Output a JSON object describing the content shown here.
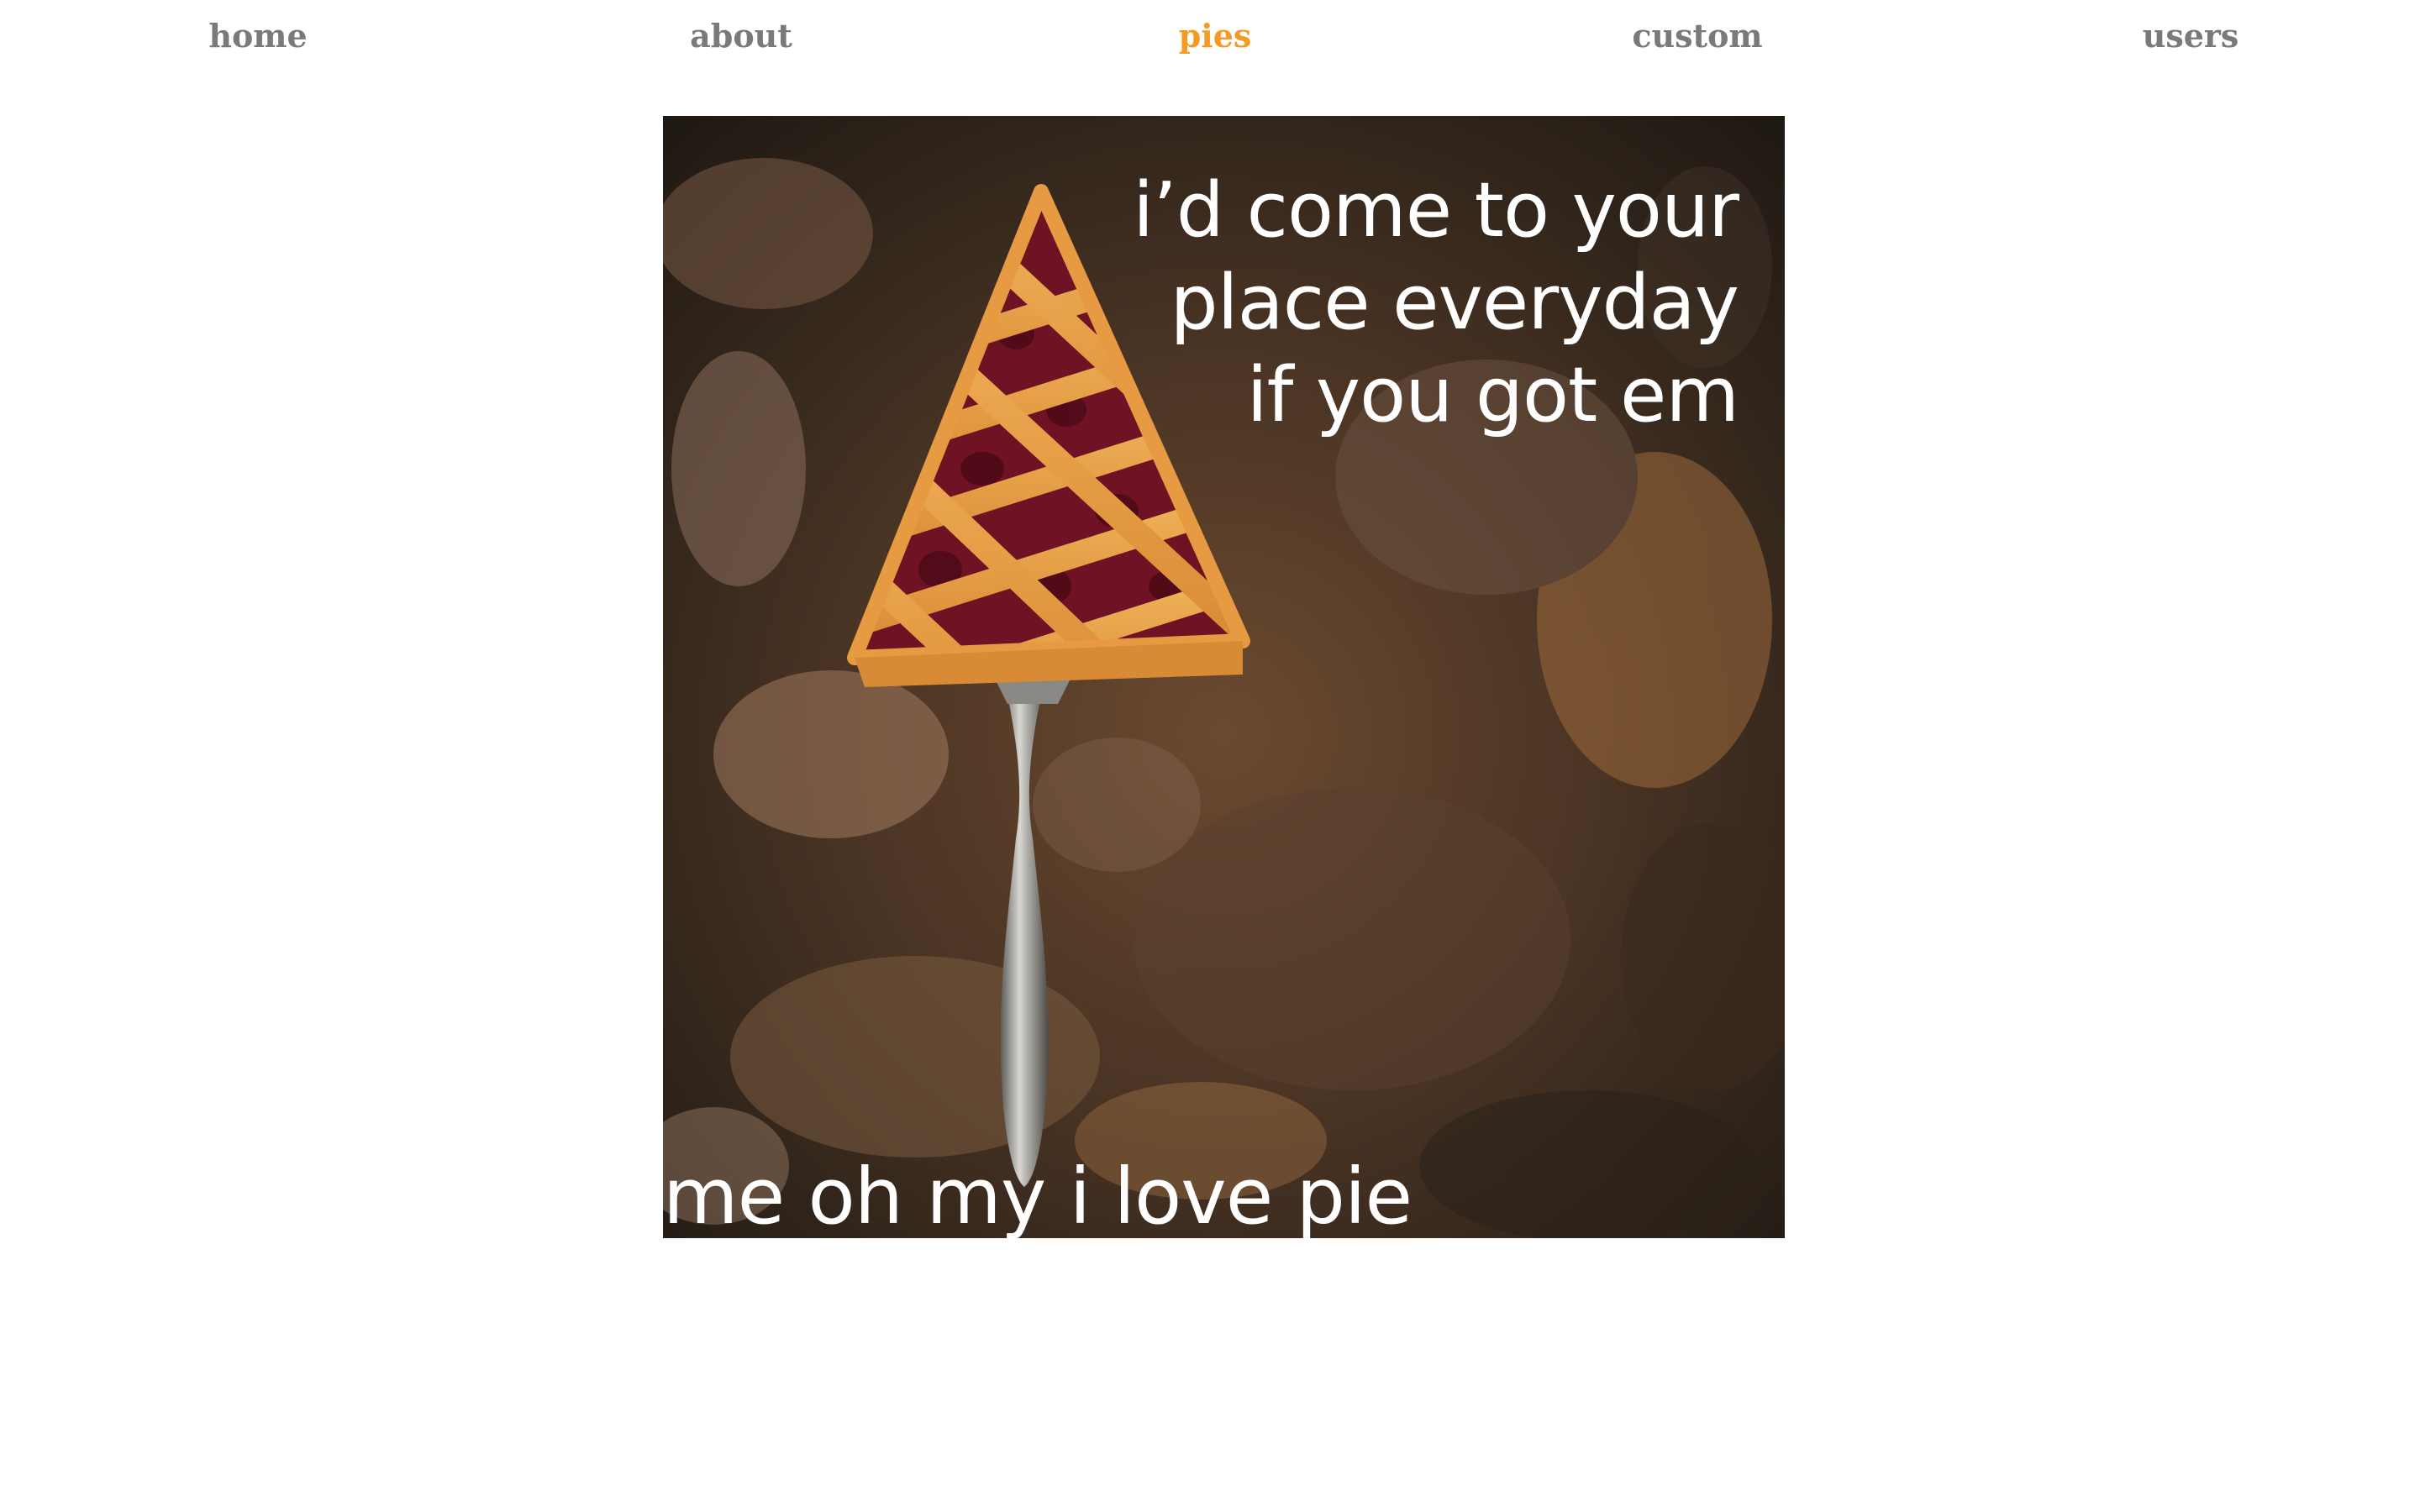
{
  "nav": {
    "items": [
      {
        "label": "home",
        "active": false
      },
      {
        "label": "about",
        "active": false
      },
      {
        "label": "pies",
        "active": true
      },
      {
        "label": "custom",
        "active": false
      },
      {
        "label": "users",
        "active": false
      }
    ],
    "active_color": "#f59a23",
    "inactive_color": "#7a7a7a"
  },
  "meme": {
    "image": "cherry-pie-slice-on-server-photo",
    "top_text": [
      "i’d come to your",
      "place everyday",
      "if you got em"
    ],
    "bottom_text": "me oh my i love pie"
  }
}
